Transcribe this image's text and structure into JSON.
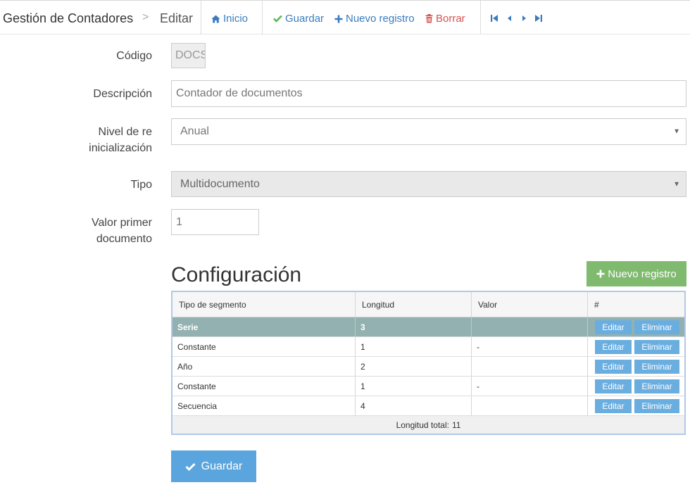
{
  "breadcrumb": {
    "title": "Gestión de Contadores",
    "separator": ">",
    "current": "Editar"
  },
  "toolbar": {
    "home_label": "Inicio",
    "save_label": "Guardar",
    "new_label": "Nuevo registro",
    "delete_label": "Borrar"
  },
  "form": {
    "codigo": {
      "label": "Código",
      "value": "DOCS"
    },
    "descripcion": {
      "label": "Descripción",
      "value": "Contador de documentos"
    },
    "nivel": {
      "label_line1": "Nivel de re",
      "label_line2": "inicialización",
      "value": "Anual"
    },
    "tipo": {
      "label": "Tipo",
      "value": "Multidocumento"
    },
    "valor": {
      "label_line1": "Valor primer",
      "label_line2": "documento",
      "value": "1"
    }
  },
  "config": {
    "title": "Configuración",
    "new_button": "Nuevo registro",
    "columns": [
      "Tipo de segmento",
      "Longitud",
      "Valor",
      "#"
    ],
    "rows": [
      {
        "tipo": "Serie",
        "longitud": "3",
        "valor": ""
      },
      {
        "tipo": "Constante",
        "longitud": "1",
        "valor": "-"
      },
      {
        "tipo": "Año",
        "longitud": "2",
        "valor": ""
      },
      {
        "tipo": "Constante",
        "longitud": "1",
        "valor": "-"
      },
      {
        "tipo": "Secuencia",
        "longitud": "4",
        "valor": ""
      }
    ],
    "edit_label": "Editar",
    "delete_label": "Eliminar",
    "footer_label": "Longitud total:",
    "footer_value": "11"
  },
  "save_button": "Guardar",
  "colors": {
    "link": "#3a7bbf",
    "check_green": "#5cb85c",
    "delete_red": "#d9534f",
    "button_green": "#7fba6e",
    "button_blue": "#5ba5de",
    "row_selected": "#93b1b0"
  },
  "icons": [
    "home-icon",
    "check-icon",
    "plus-icon",
    "trash-icon",
    "first-icon",
    "prev-icon",
    "next-icon",
    "last-icon"
  ]
}
